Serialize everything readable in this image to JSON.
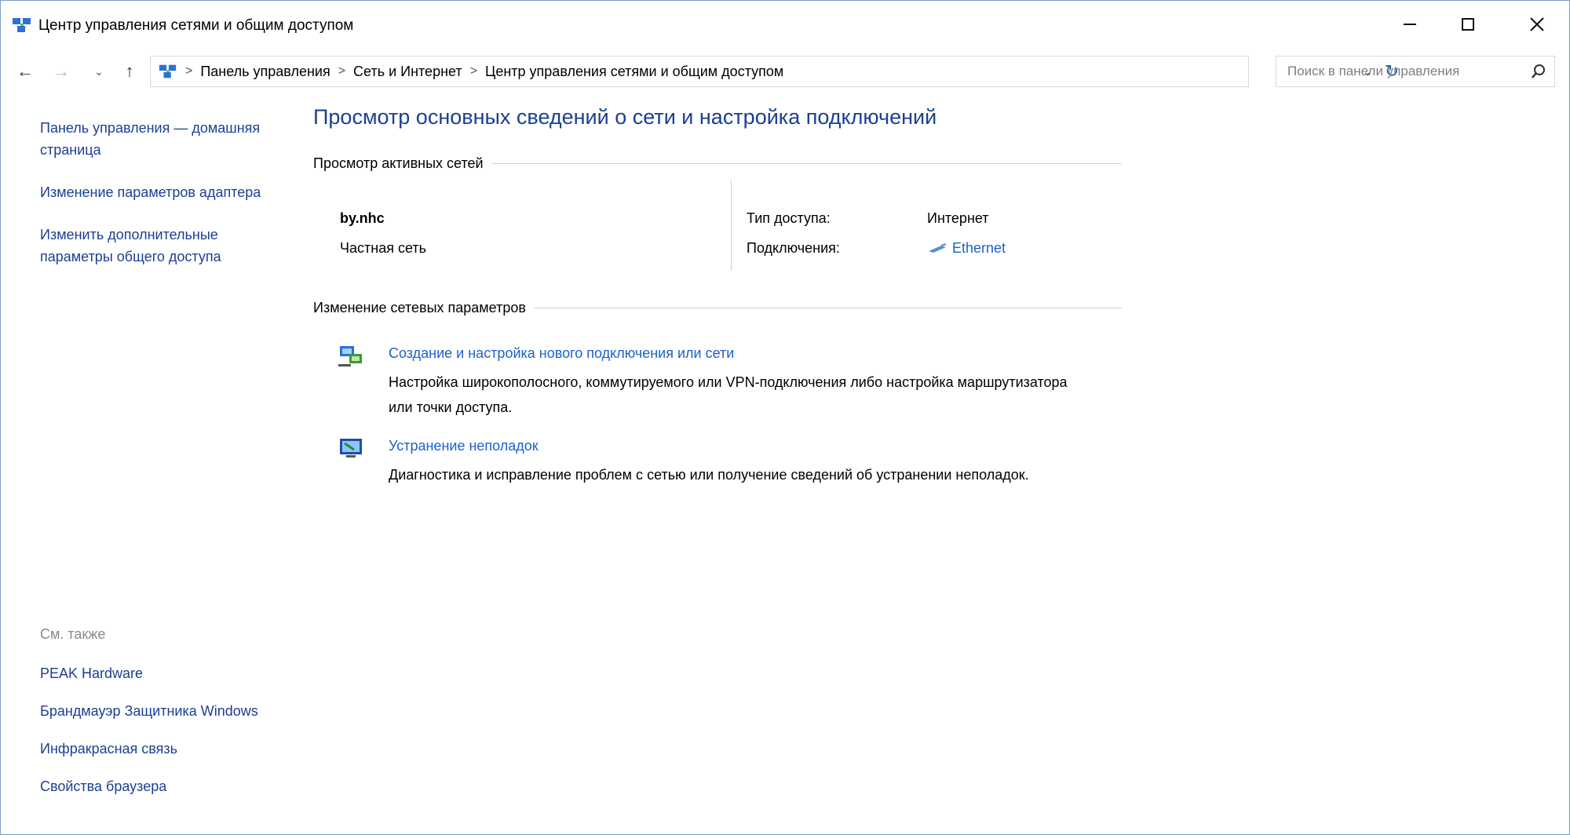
{
  "window": {
    "title": "Центр управления сетями и общим доступом"
  },
  "nav": {
    "back": "←",
    "forward": "→",
    "recent": "⌄",
    "up": "↑",
    "breadcrumbs": [
      "Панель управления",
      "Сеть и Интернет",
      "Центр управления сетями и общим доступом"
    ],
    "separator": ">",
    "dropdown": "⌄",
    "refresh": "↻",
    "search_placeholder": "Поиск в панели управления"
  },
  "leftpane": {
    "links": [
      "Панель управления — домашняя страница",
      "Изменение параметров адаптера",
      "Изменить дополнительные параметры общего доступа"
    ],
    "see_also_title": "См. также",
    "see_also": [
      "PEAK Hardware",
      "Брандмауэр Защитника Windows",
      "Инфракрасная связь",
      "Свойства браузера"
    ]
  },
  "main": {
    "title": "Просмотр основных сведений о сети и настройка подключений",
    "active_section": "Просмотр активных сетей",
    "network": {
      "name": "by.nhc",
      "type": "Частная сеть",
      "access_key": "Тип доступа:",
      "access_val": "Интернет",
      "conn_key": "Подключения:",
      "conn_val": "Ethernet"
    },
    "change_section": "Изменение сетевых параметров",
    "tasks": [
      {
        "link": "Создание и настройка нового подключения или сети",
        "desc": "Настройка широкополосного, коммутируемого или VPN-подключения либо настройка маршрутизатора или точки доступа."
      },
      {
        "link": "Устранение неполадок",
        "desc": "Диагностика и исправление проблем с сетью или получение сведений об устранении неполадок."
      }
    ]
  },
  "colors": {
    "link": "#1c62c7",
    "title": "#1c3f94",
    "muted": "#8a8a8a"
  }
}
